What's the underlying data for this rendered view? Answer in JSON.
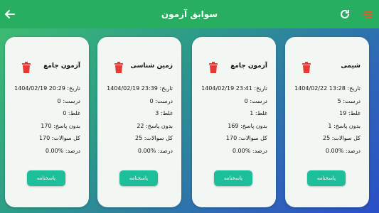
{
  "header": {
    "title": "سوابق آزمون",
    "back_icon": "arrow-left-icon",
    "refresh_icon": "refresh-icon",
    "menu_icon": "list-icon"
  },
  "colors": {
    "topbar": "#27ae60",
    "button": "#1dbf9b",
    "trash": "#e53935"
  },
  "labels": {
    "date": "تاریخ:",
    "correct": "درست:",
    "wrong": "غلط:",
    "unanswered": "بدون پاسخ:",
    "total": "کل سوالات:",
    "percent": "درصد:",
    "answers_button": "پاسخنامه"
  },
  "cards": [
    {
      "name": "آزمون جامع",
      "date": "1404/02/19 20:29",
      "correct": "0",
      "wrong": "0",
      "unanswered": "170",
      "total": "170",
      "percent": "0.00%"
    },
    {
      "name": "زمین شناسی",
      "date": "1404/02/19 23:39",
      "correct": "0",
      "wrong": "3",
      "unanswered": "22",
      "total": "25",
      "percent": "0.00%"
    },
    {
      "name": "آزمون جامع",
      "date": "1404/02/19 23:41",
      "correct": "0",
      "wrong": "1",
      "unanswered": "169",
      "total": "170",
      "percent": "0.00%"
    },
    {
      "name": "شیمی",
      "date": "1404/02/22 13:28",
      "correct": "5",
      "wrong": "19",
      "unanswered": "1",
      "total": "25",
      "percent": "0.00%"
    }
  ]
}
